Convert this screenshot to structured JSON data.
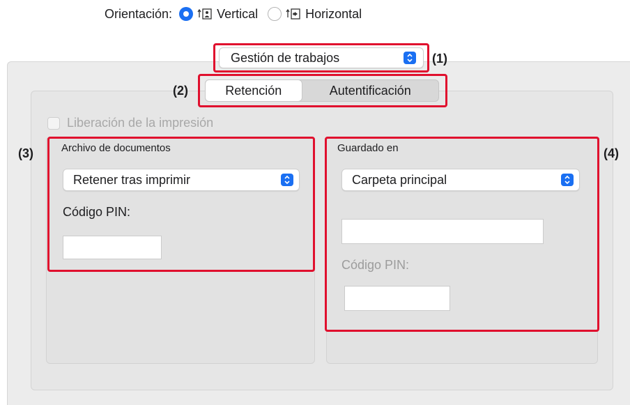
{
  "orientation": {
    "label": "Orientación:",
    "options": [
      {
        "label": "Vertical",
        "selected": true,
        "icon": "portrait-icon"
      },
      {
        "label": "Horizontal",
        "selected": false,
        "icon": "landscape-icon"
      }
    ]
  },
  "job_menu": {
    "value": "Gestión de trabajos"
  },
  "tabs": [
    {
      "label": "Retención",
      "active": true
    },
    {
      "label": "Autentificación",
      "active": false
    }
  ],
  "release": {
    "label": "Liberación de la impresión",
    "checked": false,
    "enabled": false
  },
  "document_filing": {
    "title": "Archivo de documentos",
    "select_value": "Retener tras imprimir",
    "pin_label": "Código PIN:",
    "pin_value": ""
  },
  "saved_in": {
    "title": "Guardado en",
    "select_value": "Carpeta principal",
    "folder_value": "",
    "pin_label": "Código PIN:",
    "pin_value": ""
  },
  "callouts": [
    "(1)",
    "(2)",
    "(3)",
    "(4)"
  ],
  "colors": {
    "accent": "#1a6ff2",
    "highlight": "#e0102e",
    "panel": "#ececec"
  }
}
